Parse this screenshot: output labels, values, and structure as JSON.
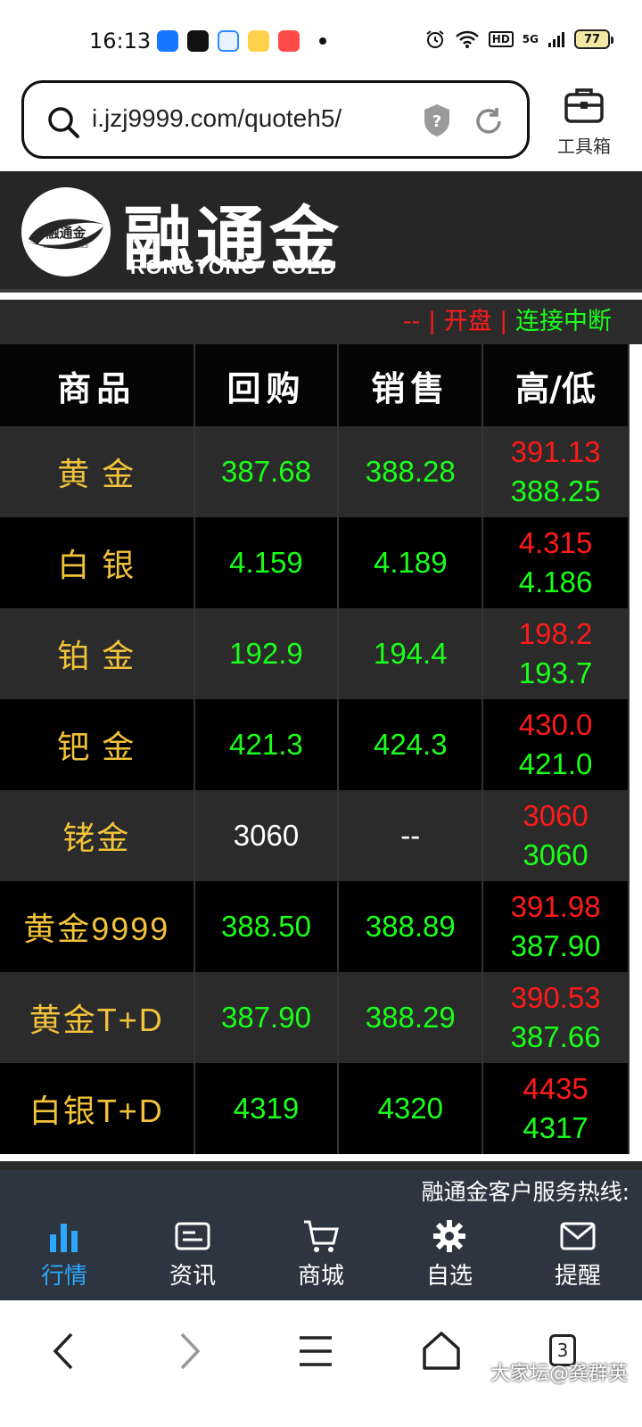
{
  "status_bar": {
    "time": "16:13",
    "battery": "77",
    "network": "5G",
    "hd": "HD"
  },
  "browser": {
    "url": "i.jzj9999.com/quoteh5/",
    "toolbox_label": "工具箱"
  },
  "brand": {
    "name_cn": "融通金",
    "name_en": "RONGTONG GOLD",
    "logo_cn": "融通金",
    "logo_en": "RONG TONG GOLD"
  },
  "connection": {
    "dash": "--",
    "sep1": "|",
    "market": "开盘",
    "sep2": "|",
    "state": "连接中断"
  },
  "table": {
    "headers": [
      "商品",
      "回购",
      "销售",
      "高/低"
    ],
    "rows": [
      {
        "name": "黄 金",
        "buy": "387.68",
        "sell": "388.28",
        "high": "391.13",
        "low": "388.25"
      },
      {
        "name": "白 银",
        "buy": "4.159",
        "sell": "4.189",
        "high": "4.315",
        "low": "4.186"
      },
      {
        "name": "铂 金",
        "buy": "192.9",
        "sell": "194.4",
        "high": "198.2",
        "low": "193.7"
      },
      {
        "name": "钯 金",
        "buy": "421.3",
        "sell": "424.3",
        "high": "430.0",
        "low": "421.0"
      },
      {
        "name": "铑金",
        "buy": "3060",
        "sell": "--",
        "high": "3060",
        "low": "3060"
      },
      {
        "name": "黄金9999",
        "buy": "388.50",
        "sell": "388.89",
        "high": "391.98",
        "low": "387.90"
      },
      {
        "name": "黄金T+D",
        "buy": "387.90",
        "sell": "388.29",
        "high": "390.53",
        "low": "387.66"
      },
      {
        "name": "白银T+D",
        "buy": "4319",
        "sell": "4320",
        "high": "4435",
        "low": "4317"
      }
    ]
  },
  "hotline": "融通金客户服务热线:",
  "tabs": [
    {
      "label": "行情",
      "icon": "chart-bars-icon",
      "active": true
    },
    {
      "label": "资讯",
      "icon": "news-card-icon"
    },
    {
      "label": "商城",
      "icon": "cart-icon"
    },
    {
      "label": "自选",
      "icon": "gear-icon"
    },
    {
      "label": "提醒",
      "icon": "mail-icon"
    }
  ],
  "system_nav": {
    "tab_count": "3",
    "watermark": "大家坛@龚群英"
  },
  "colors": {
    "up_red": "#ff1a1a",
    "down_green": "#1aff1a",
    "name_gold": "#f2c23a",
    "tab_active": "#2aa7ff"
  }
}
